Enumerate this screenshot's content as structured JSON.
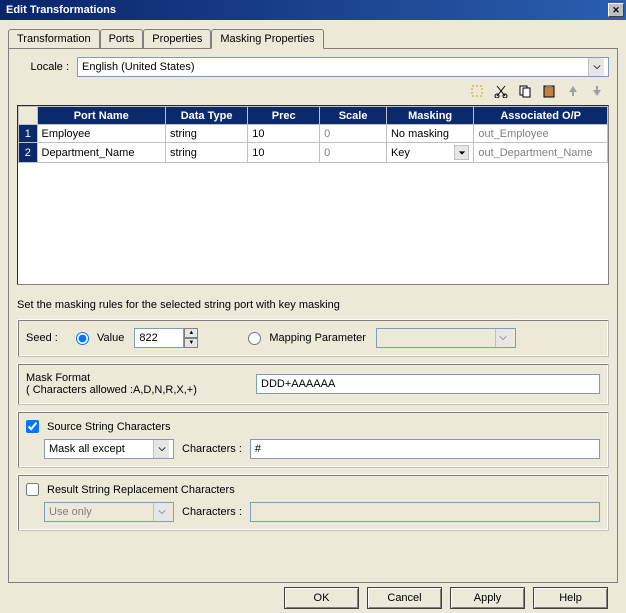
{
  "window": {
    "title": "Edit Transformations"
  },
  "tabs": [
    {
      "label": "Transformation"
    },
    {
      "label": "Ports"
    },
    {
      "label": "Properties"
    },
    {
      "label": "Masking Properties"
    }
  ],
  "active_tab": 3,
  "locale": {
    "label": "Locale :",
    "value": "English (United States)"
  },
  "table": {
    "headers": [
      "Port Name",
      "Data Type",
      "Prec",
      "Scale",
      "Masking",
      "Associated O/P"
    ],
    "rows": [
      {
        "n": "1",
        "port": "Employee",
        "dtype": "string",
        "prec": "10",
        "scale": "0",
        "masking": "No masking",
        "assoc": "out_Employee",
        "masking_combo": false
      },
      {
        "n": "2",
        "port": "Department_Name",
        "dtype": "string",
        "prec": "10",
        "scale": "0",
        "masking": "Key",
        "assoc": "out_Department_Name",
        "masking_combo": true
      }
    ]
  },
  "instruction": "Set the masking rules for the selected string port with key masking",
  "seed": {
    "label": "Seed :",
    "value_opt": "Value",
    "mapping_opt": "Mapping Parameter",
    "value": "822",
    "selected": "value"
  },
  "mask_format": {
    "label": "Mask Format",
    "hint": "( Characters allowed :A,D,N,R,X,+)",
    "value": "DDD+AAAAAA"
  },
  "source_chars": {
    "label": "Source String Characters",
    "mode": "Mask all except",
    "chars_label": "Characters :",
    "value": "#",
    "checked": true
  },
  "result_chars": {
    "label": "Result String Replacement Characters",
    "mode": "Use only",
    "chars_label": "Characters :",
    "value": "",
    "checked": false
  },
  "buttons": {
    "ok": "OK",
    "cancel": "Cancel",
    "apply": "Apply",
    "help": "Help"
  }
}
